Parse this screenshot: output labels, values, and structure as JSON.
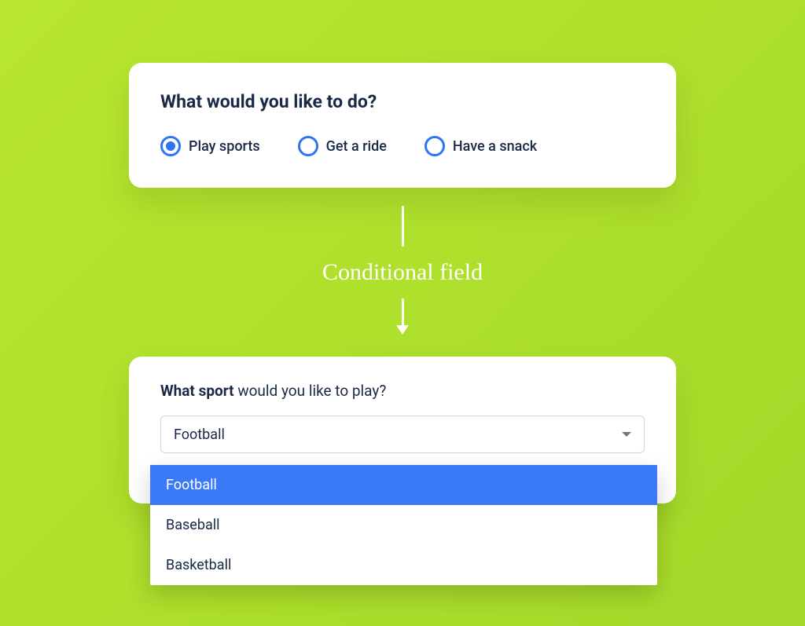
{
  "card_top": {
    "question": "What would you like to do?",
    "options": [
      {
        "label": "Play sports",
        "selected": true
      },
      {
        "label": "Get a ride",
        "selected": false
      },
      {
        "label": "Have a snack",
        "selected": false
      }
    ]
  },
  "connector": {
    "label": "Conditional field"
  },
  "card_bottom": {
    "question_bold": "What sport",
    "question_rest": " would you like to play?",
    "selected_value": "Football",
    "dropdown_options": [
      {
        "label": "Football",
        "highlighted": true
      },
      {
        "label": "Baseball",
        "highlighted": false
      },
      {
        "label": "Basketball",
        "highlighted": false
      }
    ]
  }
}
